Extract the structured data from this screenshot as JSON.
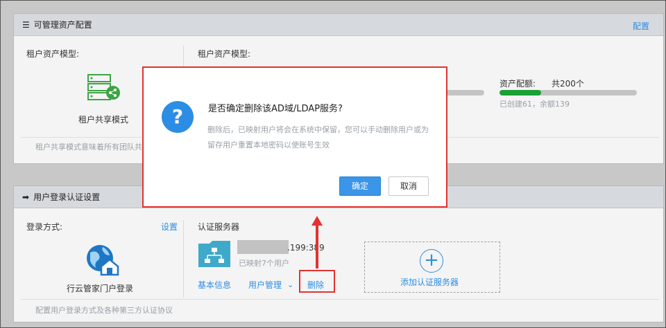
{
  "asset_panel": {
    "title": "可管理资产配置",
    "config_link": "配置",
    "left_model_label": "租户资产模型:",
    "mode_name": "租户共享模式",
    "description": "租户共享模式意味着所有团队共",
    "right_model_label": "租户资产模型:",
    "quota_label": "资产配额:",
    "quota_total": "共200个",
    "quota_detail": "已创建61，余额139",
    "quota_progress": 0.305
  },
  "login_panel": {
    "title": "用户登录认证设置",
    "login_method_label": "登录方式:",
    "settings_link": "设置",
    "portal_name": "行云管家门户登录",
    "footer_note": "配置用户登录方式及各种第三方认证协议",
    "auth_server_label": "认证服务器",
    "server_address": ".199:389",
    "mapped_users": "已映射7个用户",
    "actions": {
      "basic_info": "基本信息",
      "user_manage": "用户管理",
      "delete": "删除"
    },
    "add_server": "添加认证服务器"
  },
  "dialog": {
    "title": "是否确定删除该AD域/LDAP服务?",
    "message_line1": "删除后，已映射用户将会在系统中保留，您可以手动删除用户或为",
    "message_line2": "留存用户重置本地密码以使账号生效",
    "confirm": "确定",
    "cancel": "取消"
  },
  "colors": {
    "accent": "#2c8de4",
    "highlight": "#e23232",
    "progress": "#1aa035",
    "icon_green": "#3ca446"
  }
}
